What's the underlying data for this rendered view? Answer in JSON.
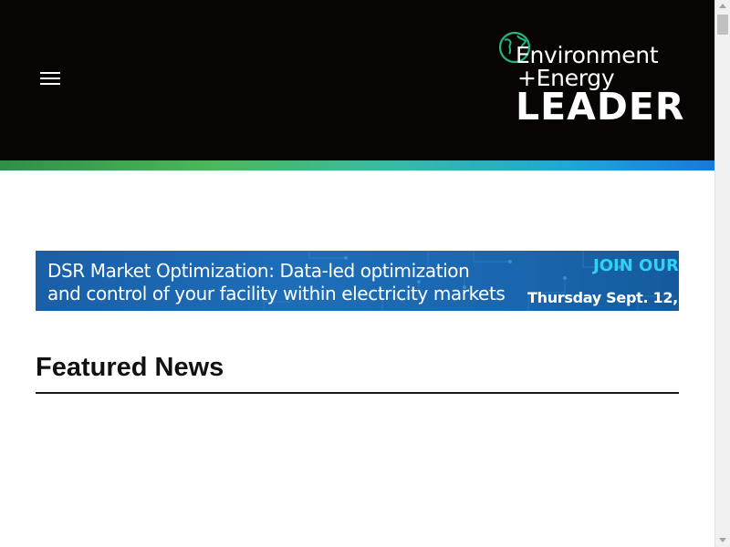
{
  "header": {
    "menu_icon": "hamburger-menu-icon",
    "logo": {
      "globe_icon": "globe-icon",
      "line1": "Environment",
      "line2": "+Energy",
      "line3": "LEADER"
    }
  },
  "banner": {
    "headline_line1": "DSR Market Optimization: Data-led optimization",
    "headline_line2": "and control of your facility within electricity markets",
    "cta": "JOIN OUR",
    "date": "Thursday Sept. 12,"
  },
  "featured": {
    "title": "Featured News"
  },
  "colors": {
    "header_bg": "#070403",
    "gradient_start": "#2f8f4a",
    "gradient_end": "#1a78d8",
    "banner_bg": "#1a66ae",
    "banner_cta": "#2fd3f0",
    "logo_globe": "#22b87a"
  }
}
